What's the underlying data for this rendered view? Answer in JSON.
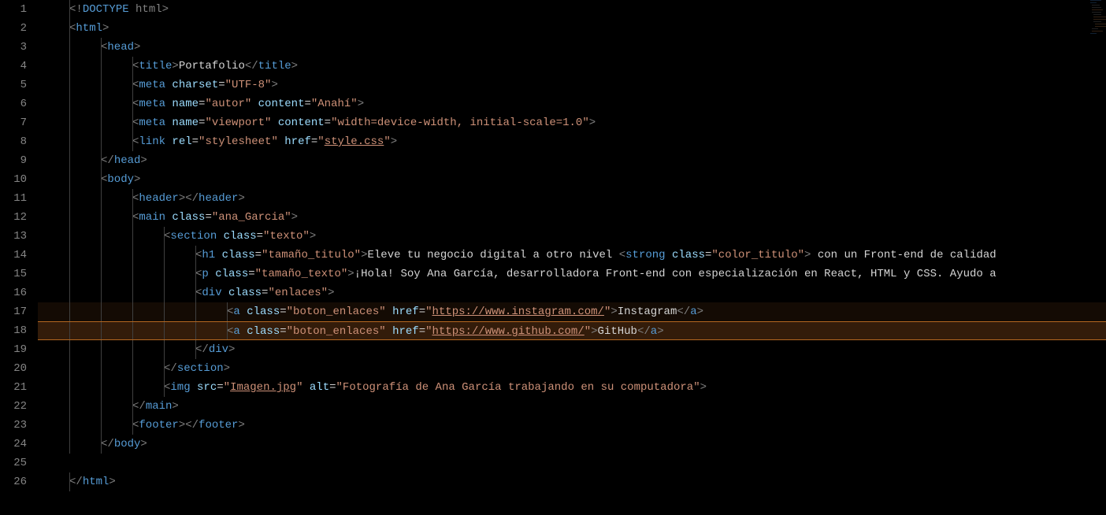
{
  "lines": [
    {
      "n": "1",
      "indent": 1,
      "segs": [
        {
          "c": "doctype",
          "t": "<!"
        },
        {
          "c": "t",
          "t": "DOCTYPE"
        },
        {
          "c": "doctype",
          "t": " html"
        },
        {
          "c": "p",
          "t": ">"
        }
      ]
    },
    {
      "n": "2",
      "indent": 1,
      "segs": [
        {
          "c": "p",
          "t": "<"
        },
        {
          "c": "t",
          "t": "html"
        },
        {
          "c": "p",
          "t": ">"
        }
      ]
    },
    {
      "n": "3",
      "indent": 2,
      "segs": [
        {
          "c": "p",
          "t": "<"
        },
        {
          "c": "t",
          "t": "head"
        },
        {
          "c": "p",
          "t": ">"
        }
      ]
    },
    {
      "n": "4",
      "indent": 3,
      "segs": [
        {
          "c": "p",
          "t": "<"
        },
        {
          "c": "t",
          "t": "title"
        },
        {
          "c": "p",
          "t": ">"
        },
        {
          "c": "tx",
          "t": "Portafolio"
        },
        {
          "c": "p",
          "t": "</"
        },
        {
          "c": "t",
          "t": "title"
        },
        {
          "c": "p",
          "t": ">"
        }
      ]
    },
    {
      "n": "5",
      "indent": 3,
      "segs": [
        {
          "c": "p",
          "t": "<"
        },
        {
          "c": "t",
          "t": "meta"
        },
        {
          "c": "tx",
          "t": " "
        },
        {
          "c": "a",
          "t": "charset"
        },
        {
          "c": "eq",
          "t": "="
        },
        {
          "c": "s",
          "t": "\"UTF-8\""
        },
        {
          "c": "p",
          "t": ">"
        }
      ]
    },
    {
      "n": "6",
      "indent": 3,
      "segs": [
        {
          "c": "p",
          "t": "<"
        },
        {
          "c": "t",
          "t": "meta"
        },
        {
          "c": "tx",
          "t": " "
        },
        {
          "c": "a",
          "t": "name"
        },
        {
          "c": "eq",
          "t": "="
        },
        {
          "c": "s",
          "t": "\"autor\""
        },
        {
          "c": "tx",
          "t": " "
        },
        {
          "c": "a",
          "t": "content"
        },
        {
          "c": "eq",
          "t": "="
        },
        {
          "c": "s",
          "t": "\"Anahí\""
        },
        {
          "c": "p",
          "t": ">"
        }
      ]
    },
    {
      "n": "7",
      "indent": 3,
      "segs": [
        {
          "c": "p",
          "t": "<"
        },
        {
          "c": "t",
          "t": "meta"
        },
        {
          "c": "tx",
          "t": " "
        },
        {
          "c": "a",
          "t": "name"
        },
        {
          "c": "eq",
          "t": "="
        },
        {
          "c": "s",
          "t": "\"viewport\""
        },
        {
          "c": "tx",
          "t": " "
        },
        {
          "c": "a",
          "t": "content"
        },
        {
          "c": "eq",
          "t": "="
        },
        {
          "c": "s",
          "t": "\"width=device-width, initial-scale=1.0\""
        },
        {
          "c": "p",
          "t": ">"
        }
      ]
    },
    {
      "n": "8",
      "indent": 3,
      "segs": [
        {
          "c": "p",
          "t": "<"
        },
        {
          "c": "t",
          "t": "link"
        },
        {
          "c": "tx",
          "t": " "
        },
        {
          "c": "a",
          "t": "rel"
        },
        {
          "c": "eq",
          "t": "="
        },
        {
          "c": "s",
          "t": "\"stylesheet\""
        },
        {
          "c": "tx",
          "t": " "
        },
        {
          "c": "a",
          "t": "href"
        },
        {
          "c": "eq",
          "t": "="
        },
        {
          "c": "s",
          "t": "\""
        },
        {
          "c": "u",
          "t": "style.css"
        },
        {
          "c": "s",
          "t": "\""
        },
        {
          "c": "p",
          "t": ">"
        }
      ]
    },
    {
      "n": "9",
      "indent": 2,
      "segs": [
        {
          "c": "p",
          "t": "</"
        },
        {
          "c": "t",
          "t": "head"
        },
        {
          "c": "p",
          "t": ">"
        }
      ]
    },
    {
      "n": "10",
      "indent": 2,
      "segs": [
        {
          "c": "p",
          "t": "<"
        },
        {
          "c": "t",
          "t": "body"
        },
        {
          "c": "p",
          "t": ">"
        }
      ]
    },
    {
      "n": "11",
      "indent": 3,
      "segs": [
        {
          "c": "p",
          "t": "<"
        },
        {
          "c": "t",
          "t": "header"
        },
        {
          "c": "p",
          "t": "></"
        },
        {
          "c": "t",
          "t": "header"
        },
        {
          "c": "p",
          "t": ">"
        }
      ]
    },
    {
      "n": "12",
      "indent": 3,
      "segs": [
        {
          "c": "p",
          "t": "<"
        },
        {
          "c": "t",
          "t": "main"
        },
        {
          "c": "tx",
          "t": " "
        },
        {
          "c": "a",
          "t": "class"
        },
        {
          "c": "eq",
          "t": "="
        },
        {
          "c": "s",
          "t": "\"ana_Garcia\""
        },
        {
          "c": "p",
          "t": ">"
        }
      ]
    },
    {
      "n": "13",
      "indent": 4,
      "segs": [
        {
          "c": "p",
          "t": "<"
        },
        {
          "c": "t",
          "t": "section"
        },
        {
          "c": "tx",
          "t": " "
        },
        {
          "c": "a",
          "t": "class"
        },
        {
          "c": "eq",
          "t": "="
        },
        {
          "c": "s",
          "t": "\"texto\""
        },
        {
          "c": "p",
          "t": ">"
        }
      ]
    },
    {
      "n": "14",
      "indent": 5,
      "segs": [
        {
          "c": "p",
          "t": "<"
        },
        {
          "c": "t",
          "t": "h1"
        },
        {
          "c": "tx",
          "t": " "
        },
        {
          "c": "a",
          "t": "class"
        },
        {
          "c": "eq",
          "t": "="
        },
        {
          "c": "s",
          "t": "\"tamaño_titulo\""
        },
        {
          "c": "p",
          "t": ">"
        },
        {
          "c": "tx",
          "t": "Eleve tu negocio digital a otro nivel "
        },
        {
          "c": "p",
          "t": "<"
        },
        {
          "c": "t",
          "t": "strong"
        },
        {
          "c": "tx",
          "t": " "
        },
        {
          "c": "a",
          "t": "class"
        },
        {
          "c": "eq",
          "t": "="
        },
        {
          "c": "s",
          "t": "\"color_titulo\""
        },
        {
          "c": "p",
          "t": ">"
        },
        {
          "c": "tx",
          "t": " con un Front-end de calidad"
        }
      ]
    },
    {
      "n": "15",
      "indent": 5,
      "segs": [
        {
          "c": "p",
          "t": "<"
        },
        {
          "c": "t",
          "t": "p"
        },
        {
          "c": "tx",
          "t": " "
        },
        {
          "c": "a",
          "t": "class"
        },
        {
          "c": "eq",
          "t": "="
        },
        {
          "c": "s",
          "t": "\"tamaño_texto\""
        },
        {
          "c": "p",
          "t": ">"
        },
        {
          "c": "tx",
          "t": "¡Hola! Soy Ana García, desarrolladora Front-end con especialización en React, HTML y CSS. Ayudo a"
        }
      ]
    },
    {
      "n": "16",
      "indent": 5,
      "segs": [
        {
          "c": "p",
          "t": "<"
        },
        {
          "c": "t",
          "t": "div"
        },
        {
          "c": "tx",
          "t": " "
        },
        {
          "c": "a",
          "t": "class"
        },
        {
          "c": "eq",
          "t": "="
        },
        {
          "c": "s",
          "t": "\"enlaces\""
        },
        {
          "c": "p",
          "t": ">"
        }
      ]
    },
    {
      "n": "17",
      "indent": 6,
      "hl": "hl17",
      "segs": [
        {
          "c": "p",
          "t": "<"
        },
        {
          "c": "t",
          "t": "a"
        },
        {
          "c": "tx",
          "t": " "
        },
        {
          "c": "a",
          "t": "class"
        },
        {
          "c": "eq",
          "t": "="
        },
        {
          "c": "s",
          "t": "\"boton_enlaces\""
        },
        {
          "c": "tx",
          "t": " "
        },
        {
          "c": "a",
          "t": "href"
        },
        {
          "c": "eq",
          "t": "="
        },
        {
          "c": "s",
          "t": "\""
        },
        {
          "c": "u",
          "t": "https://www.instagram.com/"
        },
        {
          "c": "s",
          "t": "\""
        },
        {
          "c": "p",
          "t": ">"
        },
        {
          "c": "tx",
          "t": "Instagram"
        },
        {
          "c": "p",
          "t": "</"
        },
        {
          "c": "t",
          "t": "a"
        },
        {
          "c": "p",
          "t": ">"
        }
      ]
    },
    {
      "n": "18",
      "indent": 6,
      "hl": "hl18",
      "segs": [
        {
          "c": "p",
          "t": "<"
        },
        {
          "c": "t",
          "t": "a"
        },
        {
          "c": "tx",
          "t": " "
        },
        {
          "c": "a",
          "t": "class"
        },
        {
          "c": "eq",
          "t": "="
        },
        {
          "c": "s",
          "t": "\"boton_enlaces\""
        },
        {
          "c": "tx",
          "t": " "
        },
        {
          "c": "a",
          "t": "href"
        },
        {
          "c": "eq",
          "t": "="
        },
        {
          "c": "s",
          "t": "\""
        },
        {
          "c": "u",
          "t": "https://www.github.com/"
        },
        {
          "c": "s",
          "t": "\""
        },
        {
          "c": "p",
          "t": ">"
        },
        {
          "c": "tx",
          "t": "GitHub"
        },
        {
          "c": "p",
          "t": "</"
        },
        {
          "c": "t",
          "t": "a"
        },
        {
          "c": "p",
          "t": ">"
        }
      ]
    },
    {
      "n": "19",
      "indent": 5,
      "segs": [
        {
          "c": "p",
          "t": "</"
        },
        {
          "c": "t",
          "t": "div"
        },
        {
          "c": "p",
          "t": ">"
        }
      ]
    },
    {
      "n": "20",
      "indent": 4,
      "segs": [
        {
          "c": "p",
          "t": "</"
        },
        {
          "c": "t",
          "t": "section"
        },
        {
          "c": "p",
          "t": ">"
        }
      ]
    },
    {
      "n": "21",
      "indent": 4,
      "segs": [
        {
          "c": "p",
          "t": "<"
        },
        {
          "c": "t",
          "t": "img"
        },
        {
          "c": "tx",
          "t": " "
        },
        {
          "c": "a",
          "t": "src"
        },
        {
          "c": "eq",
          "t": "="
        },
        {
          "c": "s",
          "t": "\""
        },
        {
          "c": "u",
          "t": "Imagen.jpg"
        },
        {
          "c": "s",
          "t": "\""
        },
        {
          "c": "tx",
          "t": " "
        },
        {
          "c": "a",
          "t": "alt"
        },
        {
          "c": "eq",
          "t": "="
        },
        {
          "c": "s",
          "t": "\"Fotografía de Ana García trabajando en su computadora\""
        },
        {
          "c": "p",
          "t": ">"
        }
      ]
    },
    {
      "n": "22",
      "indent": 3,
      "segs": [
        {
          "c": "p",
          "t": "</"
        },
        {
          "c": "t",
          "t": "main"
        },
        {
          "c": "p",
          "t": ">"
        }
      ]
    },
    {
      "n": "23",
      "indent": 3,
      "segs": [
        {
          "c": "p",
          "t": "<"
        },
        {
          "c": "t",
          "t": "footer"
        },
        {
          "c": "p",
          "t": "></"
        },
        {
          "c": "t",
          "t": "footer"
        },
        {
          "c": "p",
          "t": ">"
        }
      ]
    },
    {
      "n": "24",
      "indent": 2,
      "segs": [
        {
          "c": "p",
          "t": "</"
        },
        {
          "c": "t",
          "t": "body"
        },
        {
          "c": "p",
          "t": ">"
        }
      ]
    },
    {
      "n": "25",
      "indent": 0,
      "segs": []
    },
    {
      "n": "26",
      "indent": 1,
      "segs": [
        {
          "c": "p",
          "t": "</"
        },
        {
          "c": "t",
          "t": "html"
        },
        {
          "c": "p",
          "t": ">"
        }
      ]
    }
  ]
}
